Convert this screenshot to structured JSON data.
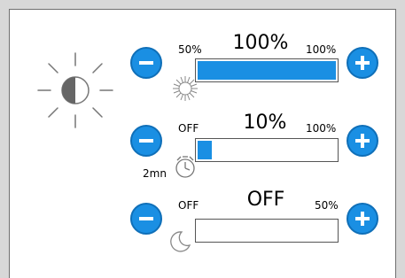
{
  "colors": {
    "accent": "#1a8fe3",
    "border": "#555555"
  },
  "controls": [
    {
      "id": "brightness",
      "min_label": "50%",
      "value_label": "100%",
      "max_label": "100%",
      "fill_fraction": 1.0,
      "icon": "sunburst-icon"
    },
    {
      "id": "timer",
      "min_label": "OFF",
      "value_label": "10%",
      "max_label": "100%",
      "fill_fraction": 0.1,
      "icon": "timer-icon",
      "timer_label": "2mn"
    },
    {
      "id": "night",
      "min_label": "OFF",
      "value_label": "OFF",
      "max_label": "50%",
      "fill_fraction": 0.0,
      "icon": "moon-icon"
    }
  ]
}
